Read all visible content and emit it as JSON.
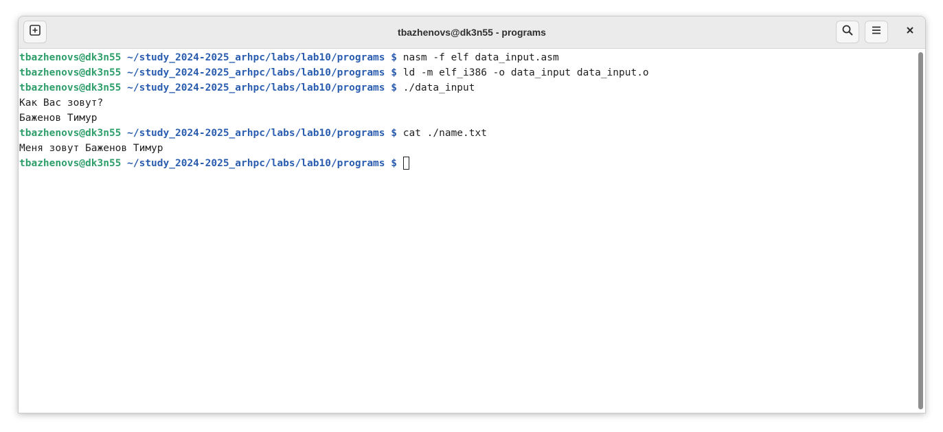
{
  "window": {
    "title": "tbazhenovs@dk3n55 - programs"
  },
  "toolbar": {
    "new_tab_icon": "new-tab-plus-icon",
    "search_icon": "search-icon",
    "menu_icon": "hamburger-menu-icon",
    "close_icon": "close-icon"
  },
  "colors": {
    "user": "#2e9e6a",
    "path": "#2a5db0",
    "text": "#1e1e1e"
  },
  "terminal": {
    "lines": [
      {
        "type": "prompt",
        "user": "tbazhenovs@dk3n55",
        "path": "~/study_2024-2025_arhpc/labs/lab10/programs",
        "symbol": "$",
        "command": "nasm -f elf data_input.asm"
      },
      {
        "type": "prompt",
        "user": "tbazhenovs@dk3n55",
        "path": "~/study_2024-2025_arhpc/labs/lab10/programs",
        "symbol": "$",
        "command": "ld -m elf_i386 -o data_input data_input.o"
      },
      {
        "type": "prompt",
        "user": "tbazhenovs@dk3n55",
        "path": "~/study_2024-2025_arhpc/labs/lab10/programs",
        "symbol": "$",
        "command": "./data_input"
      },
      {
        "type": "output",
        "text": "Как Вас зовут?"
      },
      {
        "type": "output",
        "text": "Баженов Тимур"
      },
      {
        "type": "prompt",
        "user": "tbazhenovs@dk3n55",
        "path": "~/study_2024-2025_arhpc/labs/lab10/programs",
        "symbol": "$",
        "command": "cat ./name.txt"
      },
      {
        "type": "output",
        "text": "Меня зовут Баженов Тимур"
      },
      {
        "type": "prompt",
        "user": "tbazhenovs@dk3n55",
        "path": "~/study_2024-2025_arhpc/labs/lab10/programs",
        "symbol": "$",
        "command": ""
      }
    ]
  }
}
